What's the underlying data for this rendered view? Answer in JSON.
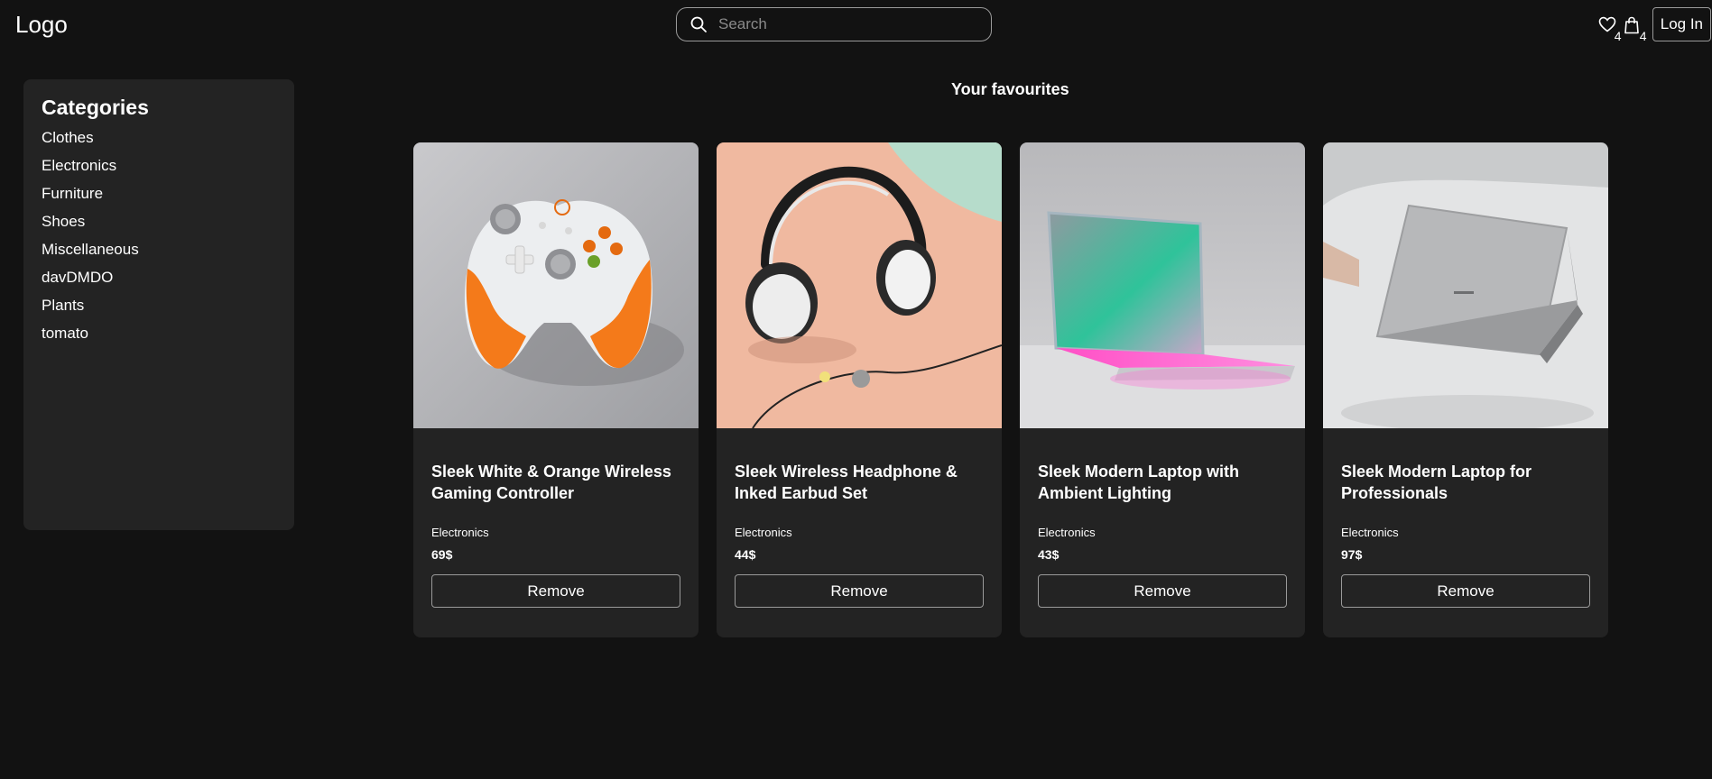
{
  "header": {
    "logo": "Logo",
    "search_placeholder": "Search",
    "favourites_count": "4",
    "cart_count": "4",
    "login_label": "Log In"
  },
  "sidebar": {
    "title": "Categories",
    "items": [
      {
        "label": "Clothes"
      },
      {
        "label": "Electronics"
      },
      {
        "label": "Furniture"
      },
      {
        "label": "Shoes"
      },
      {
        "label": "Miscellaneous"
      },
      {
        "label": "davDMDO"
      },
      {
        "label": "Plants"
      },
      {
        "label": "tomato"
      }
    ]
  },
  "main": {
    "title": "Your favourites",
    "products": [
      {
        "title": "Sleek White & Orange Wireless Gaming Controller",
        "category": "Electronics",
        "price": "69$",
        "remove_label": "Remove",
        "image": "gaming-controller"
      },
      {
        "title": "Sleek Wireless Headphone & Inked Earbud Set",
        "category": "Electronics",
        "price": "44$",
        "remove_label": "Remove",
        "image": "headphones"
      },
      {
        "title": "Sleek Modern Laptop with Ambient Lighting",
        "category": "Electronics",
        "price": "43$",
        "remove_label": "Remove",
        "image": "laptop-ambient"
      },
      {
        "title": "Sleek Modern Laptop for Professionals",
        "category": "Electronics",
        "price": "97$",
        "remove_label": "Remove",
        "image": "laptop-professional"
      }
    ]
  },
  "colors": {
    "background": "#121212",
    "panel": "#232323",
    "border": "#9a9a9a",
    "text": "#ffffff"
  }
}
